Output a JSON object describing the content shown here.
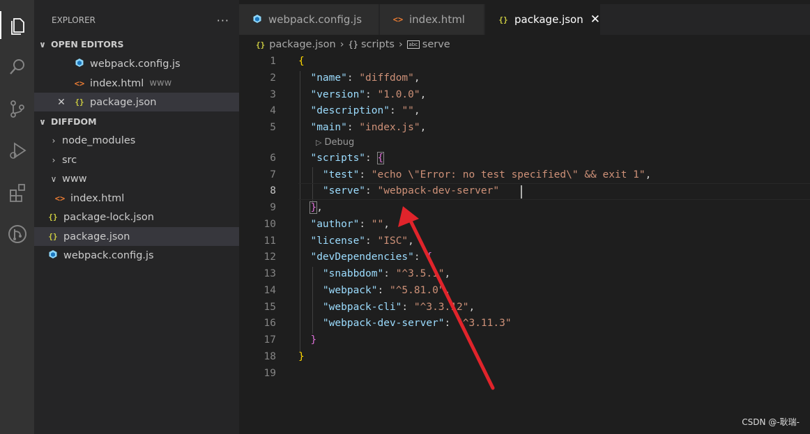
{
  "activity_bar": {
    "items": [
      {
        "name": "explorer-icon"
      },
      {
        "name": "search-icon"
      },
      {
        "name": "source-control-icon"
      },
      {
        "name": "run-debug-icon"
      },
      {
        "name": "extensions-icon"
      },
      {
        "name": "git-graph-icon"
      }
    ]
  },
  "sidebar": {
    "title": "EXPLORER",
    "more_actions": "···",
    "open_editors_label": "OPEN EDITORS",
    "open_editors": [
      {
        "label": "webpack.config.js",
        "hint": ""
      },
      {
        "label": "index.html",
        "hint": "www"
      },
      {
        "label": "package.json",
        "hint": ""
      }
    ],
    "project_label": "DIFFDOM",
    "tree": [
      {
        "label": "node_modules"
      },
      {
        "label": "src"
      },
      {
        "label": "www"
      },
      {
        "label": "index.html"
      },
      {
        "label": "package-lock.json"
      },
      {
        "label": "package.json"
      },
      {
        "label": "webpack.config.js"
      }
    ]
  },
  "tabs": [
    {
      "label": "webpack.config.js"
    },
    {
      "label": "index.html"
    },
    {
      "label": "package.json"
    }
  ],
  "breadcrumb": {
    "file": "package.json",
    "obj": "scripts",
    "prop": "serve",
    "icon_text": "abc"
  },
  "editor": {
    "codelens": "Debug",
    "lines": {
      "l1": [
        "{"
      ],
      "l2": [
        "\"name\"",
        ": ",
        "\"diffdom\"",
        ","
      ],
      "l3": [
        "\"version\"",
        ": ",
        "\"1.0.0\"",
        ","
      ],
      "l4": [
        "\"description\"",
        ": ",
        "\"\"",
        ","
      ],
      "l5": [
        "\"main\"",
        ": ",
        "\"index.js\"",
        ","
      ],
      "l6": [
        "\"scripts\"",
        ": ",
        "{"
      ],
      "l7": [
        "\"test\"",
        ": ",
        "\"echo \\\"Error: no test specified\\\" && exit 1\"",
        ","
      ],
      "l8": [
        "\"serve\"",
        ": ",
        "\"webpack-dev-server\""
      ],
      "l9": [
        "}",
        ","
      ],
      "l10": [
        "\"author\"",
        ": ",
        "\"\"",
        ","
      ],
      "l11": [
        "\"license\"",
        ": ",
        "\"ISC\"",
        ","
      ],
      "l12": [
        "\"devDependencies\"",
        ": ",
        "{"
      ],
      "l13": [
        "\"snabbdom\"",
        ": ",
        "\"^3.5.1\"",
        ","
      ],
      "l14": [
        "\"webpack\"",
        ": ",
        "\"^5.81.0\"",
        ","
      ],
      "l15": [
        "\"webpack-cli\"",
        ": ",
        "\"^3.3.12\"",
        ","
      ],
      "l16": [
        "\"webpack-dev-server\"",
        ": ",
        "\"^3.11.3\""
      ],
      "l17": [
        "}"
      ],
      "l18": [
        "}"
      ]
    },
    "line_numbers": [
      "1",
      "2",
      "3",
      "4",
      "5",
      "6",
      "7",
      "8",
      "9",
      "10",
      "11",
      "12",
      "13",
      "14",
      "15",
      "16",
      "17",
      "18",
      "19"
    ]
  },
  "watermark": "CSDN @-耿瑞-",
  "colors": {
    "activity_bg": "#333333",
    "sidebar_bg": "#252526",
    "editor_bg": "#1e1e1e",
    "json_key": "#9cdcfe",
    "json_string": "#ce9178",
    "annotation_arrow": "#e0242b"
  }
}
